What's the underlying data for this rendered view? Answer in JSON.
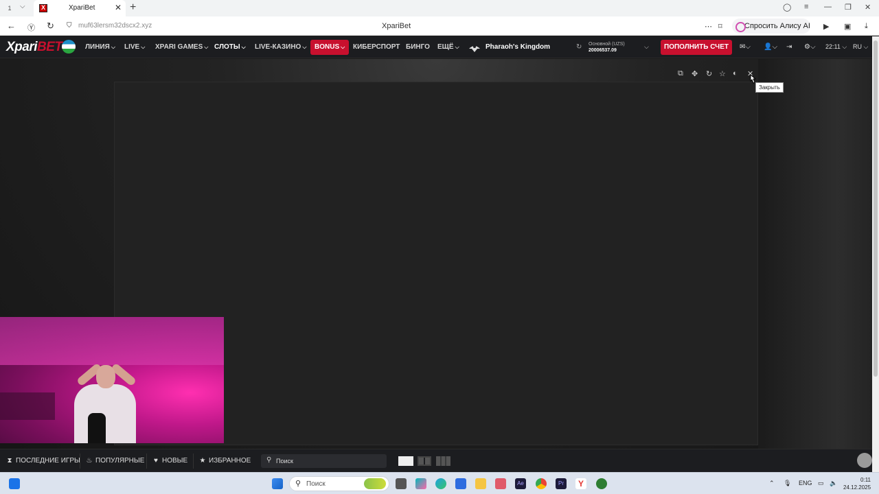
{
  "browser": {
    "tab_count": "1",
    "tab_title": "XpariBet",
    "url": "muf63lersm32dscx2.xyz",
    "page_title": "XpariBet",
    "alisa_label": "Спросить Алису AI"
  },
  "site": {
    "logo_main": "Xpari",
    "logo_accent": "BET",
    "nav": [
      {
        "label": "ЛИНИЯ"
      },
      {
        "label": "LIVE"
      },
      {
        "label": "XPARI GAMES"
      },
      {
        "label": "СЛОТЫ"
      },
      {
        "label": "LIVE-КАЗИНО"
      },
      {
        "label": "BONUS"
      },
      {
        "label": "КИБЕРСПОРТ"
      },
      {
        "label": "БИНГО"
      },
      {
        "label": "ЕЩЁ"
      }
    ],
    "featured_game": "Pharaoh's Kingdom",
    "balance_label": "Основной (UZS)",
    "balance_value": "20006537.09",
    "deposit_label": "ПОПОЛНИТЬ СЧЕТ",
    "time": "22:11",
    "language": "RU"
  },
  "game": {
    "close_tooltip": "Закрыть"
  },
  "bottom": {
    "recent": "ПОСЛЕДНИЕ ИГРЫ",
    "popular": "ПОПУЛЯРНЫЕ",
    "new": "НОВЫЕ",
    "favorites": "ИЗБРАННОЕ",
    "search_placeholder": "Поиск"
  },
  "taskbar": {
    "search_label": "Поиск",
    "lang": "ENG",
    "time": "0:11",
    "date": "24.12.2025"
  }
}
